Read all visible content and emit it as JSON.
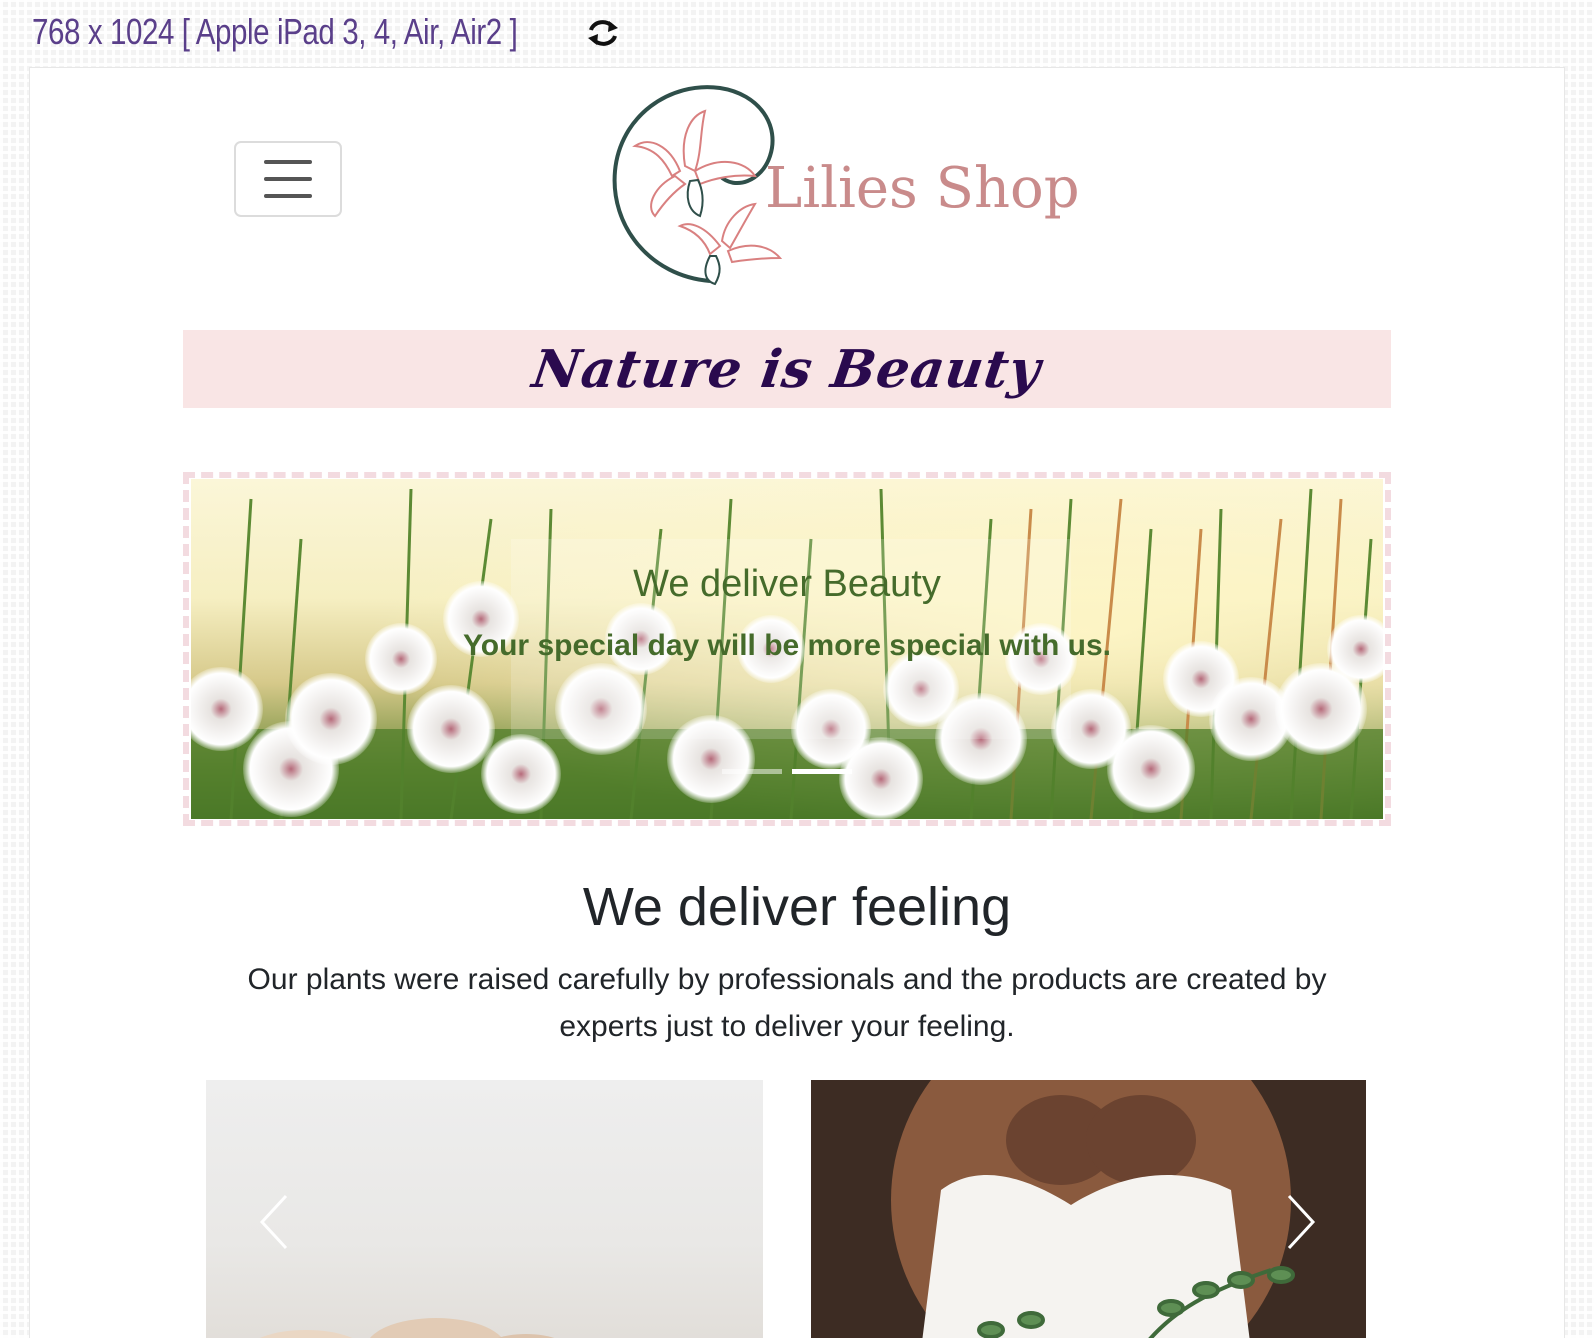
{
  "toolbar": {
    "device_label": "768 x 1024 [ Apple iPad 3, 4, Air, Air2 ]",
    "rotate_icon": "rotate-icon"
  },
  "header": {
    "logo_text": "Lilies Shop",
    "menu_icon": "hamburger-menu-icon"
  },
  "banner": {
    "slogan": "Nature is Beauty"
  },
  "carousel": {
    "title": "We deliver Beauty",
    "subtitle": "Your special day will be more special with us.",
    "slides": 2,
    "active_slide": 2
  },
  "intro": {
    "title": "We deliver feeling",
    "text": "Our plants were raised carefully by professionals and the products are created by experts just to deliver your feeling."
  },
  "colors": {
    "slogan_bg": "#f9e5e5",
    "slogan_text": "#2a0a4e",
    "logo_text": "#c98b8b",
    "caption_text": "#456b2b",
    "device_label": "#5a3f8a"
  }
}
